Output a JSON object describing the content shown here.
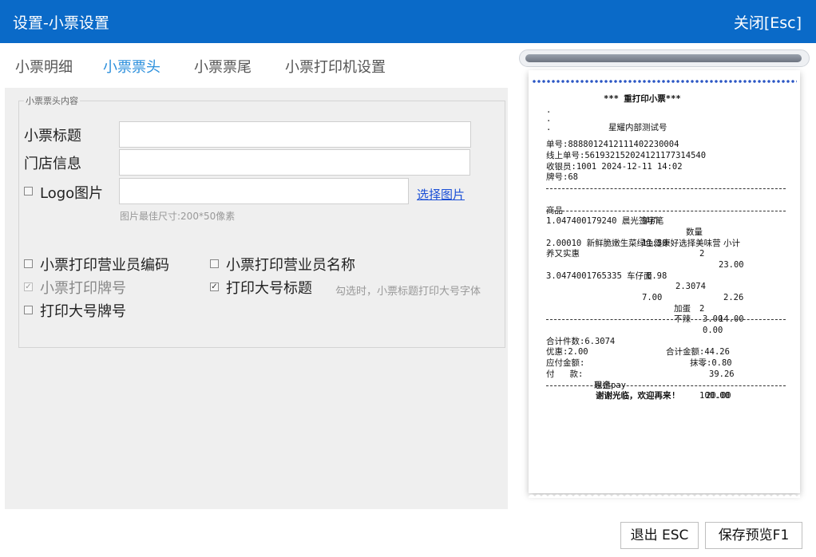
{
  "titlebar": {
    "title": "设置-小票设置",
    "close_label": "关闭[Esc]"
  },
  "tabs": [
    {
      "label": "小票明细",
      "active": false
    },
    {
      "label": "小票票头",
      "active": true
    },
    {
      "label": "小票票尾",
      "active": false
    },
    {
      "label": "小票打印机设置",
      "active": false
    }
  ],
  "header_group": {
    "legend": "小票票头内容",
    "ticket_title_label": "小票标题",
    "ticket_title_value": "",
    "store_info_label": "门店信息",
    "store_info_value": "",
    "logo_label": "Logo图片",
    "logo_checked": false,
    "logo_value": "",
    "select_image_link": "选择图片",
    "image_hint": "图片最佳尺寸:200*50像素"
  },
  "options": {
    "print_clerk_code": {
      "label": "小票打印营业员编码",
      "checked": false
    },
    "print_clerk_name": {
      "label": "小票打印营业员名称",
      "checked": false
    },
    "print_plate_no": {
      "label": "小票打印牌号",
      "checked": true,
      "disabled": true
    },
    "print_large_title": {
      "label": "打印大号标题",
      "checked": true
    },
    "large_title_hint": "勾选时，小票标题打印大号字体",
    "print_large_plate": {
      "label": "打印大号牌号",
      "checked": false
    }
  },
  "receipt": {
    "heading": "*** 重打印小票***",
    "dots": [
      ".",
      ".",
      "."
    ],
    "store_name": "星耀内部测试号",
    "order_no": "单号:8888012412111402230004",
    "online_order_no": "线上单号:5619321520241211773145​40",
    "cashier": "收银员:1001 2024-12-11 14:02",
    "plate_no": "牌号:68",
    "col_item": "商品",
    "col_price": "单价",
    "col_qty": "数量",
    "col_subtotal": "小计",
    "items": [
      {
        "name": "1.047400179240 晨光签字笔",
        "name2": "",
        "price": "11.50",
        "qty": "2",
        "subtotal": "23.00"
      },
      {
        "name": "2.00010 新鲜脆嫩生菜绿色健康好选择美味营",
        "name2": "养又实惠",
        "price": "0.98",
        "qty": "2.3074",
        "subtotal": "2.26"
      },
      {
        "name": "3.0474001765335 车仔面",
        "name2": "",
        "price": "7.00",
        "qty": "2",
        "subtotal": "14.00"
      }
    ],
    "extra1_label": "加蛋",
    "extra1_value": "3.00",
    "extra2_label": "不辣",
    "extra2_value": "0.00",
    "total_qty": "合计件数:6.3074",
    "total_amount": "合计金额:44.26",
    "discount": "优惠:2.00",
    "rounding": "抹零:0.80",
    "payable_label": "应付金额:",
    "payable_value": "39.26",
    "pay_label": "付   款:",
    "pay1_method": "现金",
    "pay1_value": "100.00",
    "pay2_method": "思迅pay",
    "pay2_value": "20.00",
    "footer": "谢谢光临，欢迎再来!"
  },
  "buttons": {
    "exit": "退出 ESC",
    "save_preview": "保存预览F1"
  }
}
